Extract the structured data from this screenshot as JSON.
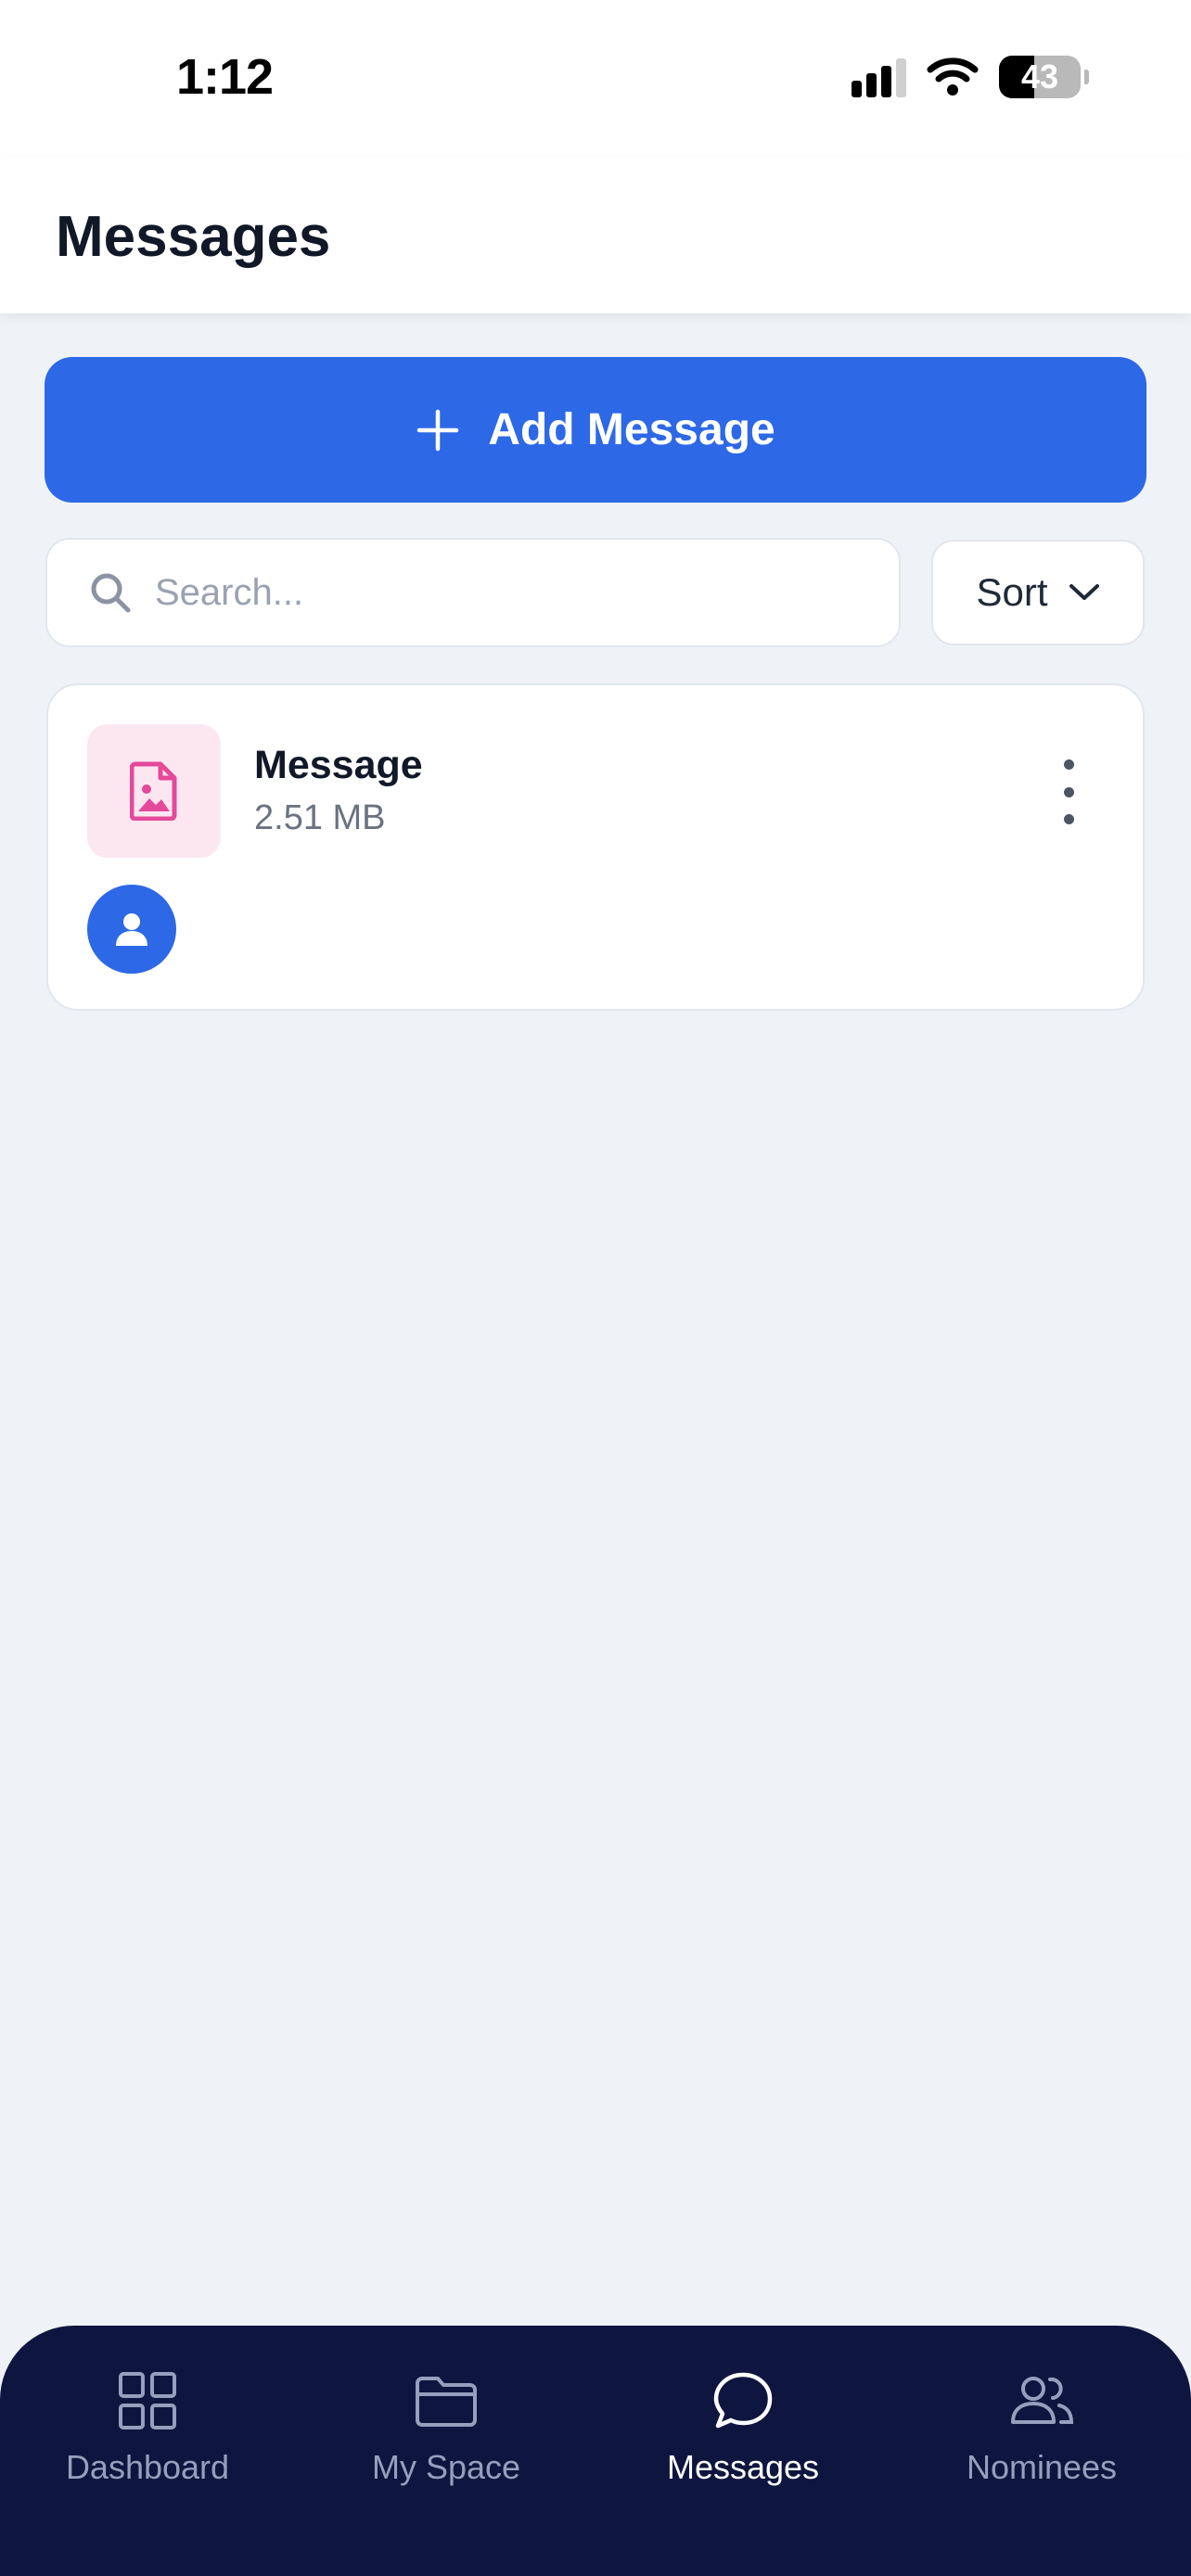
{
  "status_bar": {
    "time": "1:12",
    "battery": "43",
    "battery_level": 0.43
  },
  "header": {
    "title": "Messages"
  },
  "actions": {
    "add_label": "Add Message",
    "search_placeholder": "Search...",
    "search_value": "",
    "sort_label": "Sort"
  },
  "messages": [
    {
      "name": "Message",
      "size": "2.51 MB",
      "icon": "image-file-icon",
      "owner_icon": "user-icon"
    }
  ],
  "tabs": [
    {
      "label": "Dashboard",
      "icon": "grid-icon",
      "active": false
    },
    {
      "label": "My Space",
      "icon": "folder-icon",
      "active": false
    },
    {
      "label": "Messages",
      "icon": "chat-bubble-icon",
      "active": true
    },
    {
      "label": "Nominees",
      "icon": "users-icon",
      "active": false
    }
  ],
  "colors": {
    "primary": "#2d68e6",
    "background": "#eff2f7",
    "tabbar": "#0e163f",
    "file_icon": "#e4499a",
    "file_tile": "#fce7f1"
  }
}
